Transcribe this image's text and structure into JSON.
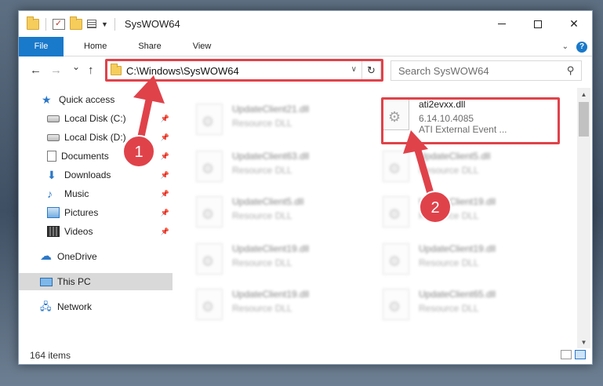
{
  "window": {
    "title": "SysWOW64",
    "caption": {
      "minimize": "",
      "maximize": "",
      "close": "✕"
    }
  },
  "ribbon": {
    "tabs": [
      "File",
      "Home",
      "Share",
      "View"
    ],
    "help": "?"
  },
  "nav": {
    "back": "←",
    "forward": "→",
    "recent": "⌄",
    "up": "↑",
    "address": "C:\\Windows\\SysWOW64",
    "refresh": "↻",
    "search_placeholder": "Search SysWOW64"
  },
  "sidebar": {
    "items": [
      {
        "label": "Quick access",
        "icon": "star-icon"
      },
      {
        "label": "Local Disk (C:)",
        "icon": "drive-icon",
        "pinned": true
      },
      {
        "label": "Local Disk (D:)",
        "icon": "drive-icon",
        "pinned": true
      },
      {
        "label": "Documents",
        "icon": "documents-icon",
        "pinned": true
      },
      {
        "label": "Downloads",
        "icon": "download-icon",
        "pinned": true
      },
      {
        "label": "Music",
        "icon": "music-icon",
        "pinned": true
      },
      {
        "label": "Pictures",
        "icon": "pictures-icon",
        "pinned": true
      },
      {
        "label": "Videos",
        "icon": "videos-icon",
        "pinned": true
      },
      {
        "label": "OneDrive",
        "icon": "cloud-icon"
      },
      {
        "label": "This PC",
        "icon": "computer-icon",
        "selected": true
      },
      {
        "label": "Network",
        "icon": "network-icon"
      }
    ]
  },
  "files": [
    {
      "name": "UpdateClient21.dll",
      "desc": "Resource DLL"
    },
    {
      "name": "ati2evxx.dll",
      "version": "6.14.10.4085",
      "desc": "ATI External Event ..."
    },
    {
      "name": "UpdateClient63.dll",
      "desc": "Resource DLL"
    },
    {
      "name": "UpdateClient5.dll",
      "desc": "Resource DLL"
    },
    {
      "name": "UpdateClient5.dll",
      "desc": "Resource DLL"
    },
    {
      "name": "UpdateClient19.dll",
      "desc": "Resource DLL"
    },
    {
      "name": "UpdateClient19.dll",
      "desc": "Resource DLL"
    },
    {
      "name": "UpdateClient19.dll",
      "desc": "Resource DLL"
    },
    {
      "name": "UpdateClient19.dll",
      "desc": "Resource DLL"
    },
    {
      "name": "UpdateClient65.dll",
      "desc": "Resource DLL"
    }
  ],
  "status": {
    "items_count": "164 items"
  },
  "annotations": {
    "step1": "1",
    "step2": "2",
    "color": "#e0424a"
  }
}
